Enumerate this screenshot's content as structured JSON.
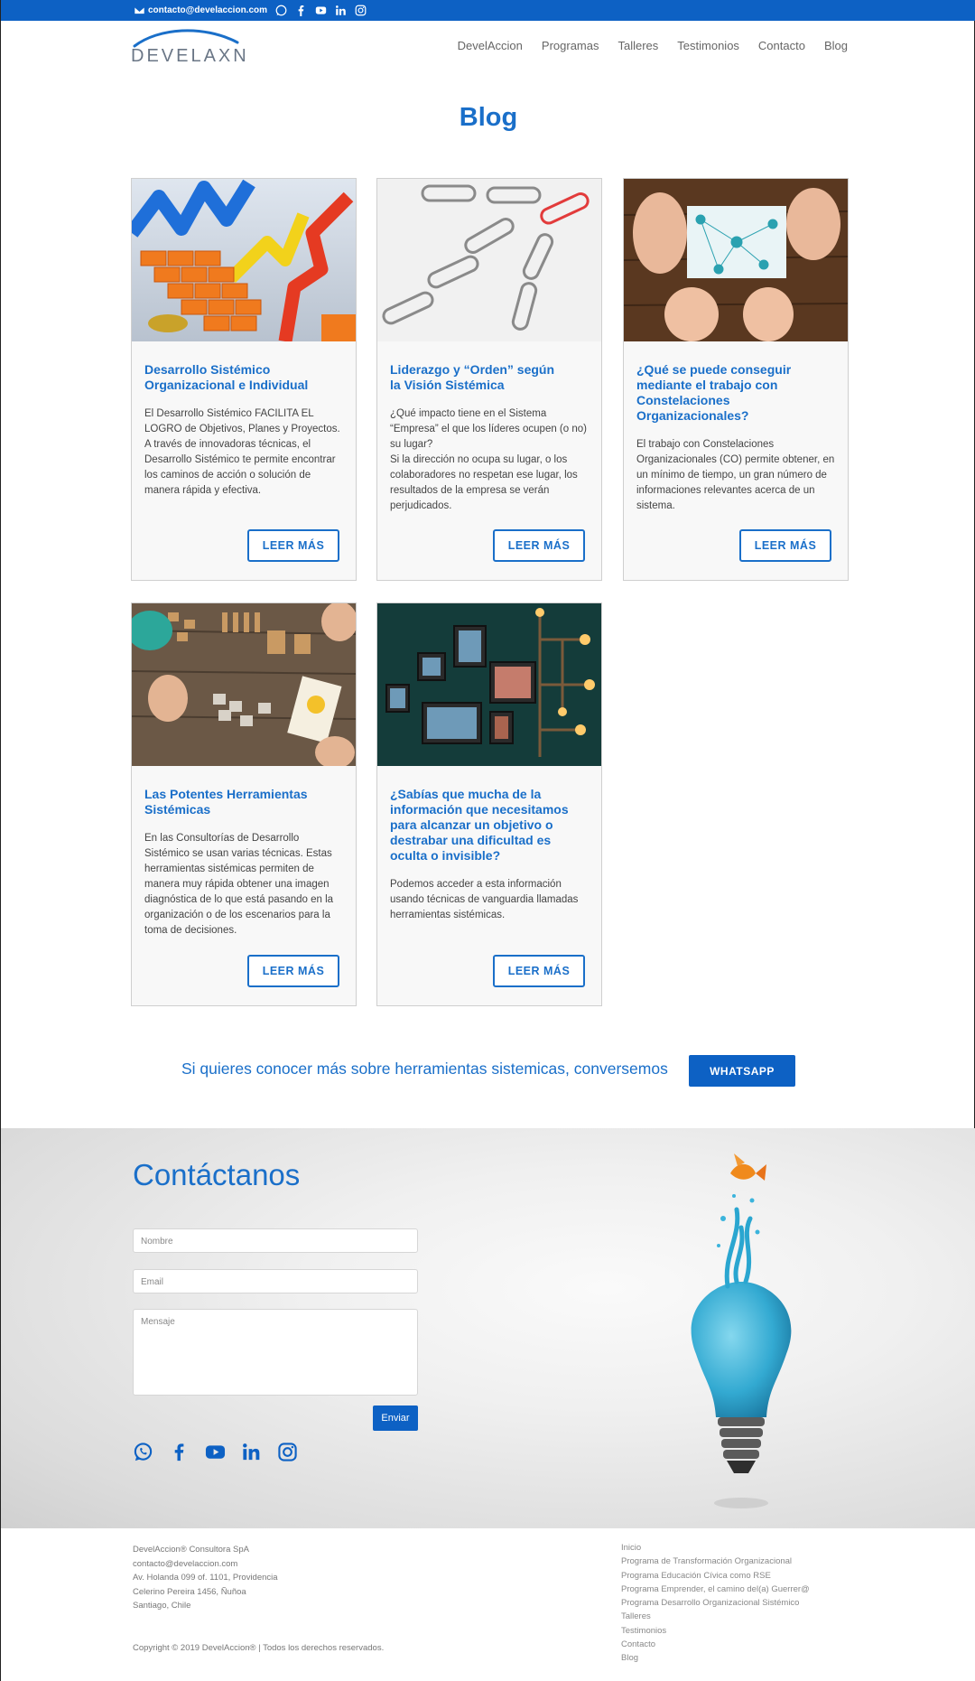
{
  "topbar": {
    "email": "contacto@develaccion.com",
    "icons": [
      "envelope-icon",
      "whatsapp-icon",
      "facebook-icon",
      "youtube-icon",
      "linkedin-icon",
      "instagram-icon"
    ]
  },
  "header": {
    "logo_text": "DEVELAXN",
    "nav": [
      "DevelAccion",
      "Programas",
      "Talleres",
      "Testimonios",
      "Contacto",
      "Blog"
    ]
  },
  "page": {
    "title": "Blog"
  },
  "posts": [
    {
      "title": "Desarrollo Sistémico\nOrganizacional e Individual",
      "excerpt": "El Desarrollo Sistémico FACILITA EL LOGRO de Objetivos, Planes y Proyectos. A través de innovadoras técnicas, el Desarrollo Sistémico te permite encontrar los caminos de acción o solución de manera rápida y efectiva.",
      "button": "LEER MÁS",
      "image": "arrows-and-bricks-image"
    },
    {
      "title": "Liderazgo y “Orden” según\nla Visión Sistémica",
      "excerpt": "¿Qué impacto tiene en el Sistema “Empresa” el que los líderes ocupen (o no) su lugar?\nSi la dirección no ocupa su lugar, o los colaboradores no respetan ese lugar, los resultados de la empresa se verán perjudicados.",
      "button": "LEER MÁS",
      "image": "paper-clips-image"
    },
    {
      "title": "¿Qué se puede conseguir mediante el trabajo con Constelaciones Organizacionales?",
      "excerpt": "El trabajo con Constelaciones Organizacionales (CO) permite obtener, en un mínimo de tiempo, un gran número de informaciones relevantes acerca de un sistema.",
      "button": "LEER MÁS",
      "image": "puzzle-network-image"
    },
    {
      "title": "Las Potentes Herramientas Sistémicas",
      "excerpt": "En las Consultorías de Desarrollo Sistémico se usan varias técnicas. Estas herramientas sistémicas permiten de manera muy rápida obtener una imagen diagnóstica de lo que está pasando en la organización o de los escenarios para la toma de decisiones.",
      "button": "LEER MÁS",
      "image": "puzzle-table-image"
    },
    {
      "title": "¿Sabías que mucha de la información que necesitamos para alcanzar un objetivo o destrabar una dificultad es oculta o invisible?",
      "excerpt": "Podemos acceder a esta información usando técnicas de vanguardia llamadas herramientas sistémicas.",
      "button": "LEER MÁS",
      "image": "frames-wall-image"
    }
  ],
  "cta": {
    "text": "Si quieres conocer más sobre herramientas sistemicas, conversemos",
    "button": "WHATSAPP"
  },
  "contact": {
    "title": "Contáctanos",
    "name_placeholder": "Nombre",
    "email_placeholder": "Email",
    "message_placeholder": "Mensaje",
    "send": "Enviar",
    "socials": [
      "whatsapp-icon",
      "facebook-icon",
      "youtube-icon",
      "linkedin-icon",
      "instagram-icon"
    ]
  },
  "footer": {
    "company": "DevelAccion® Consultora SpA",
    "email": "contacto@develaccion.com",
    "address1": "Av. Holanda 099 of. 1101, Providencia",
    "address2": "Celerino Pereira 1456, Ñuñoa",
    "city": "Santiago, Chile",
    "copyright": "Copyright © 2019 DevelAccion® | Todos los derechos reservados.",
    "links": [
      "Inicio",
      "Programa de Transformación Organizacional",
      "Programa Educación Cívica como RSE",
      "Programa Emprender, el camino del(a) Guerrer@",
      "Programa Desarrollo Organizacional Sistémico",
      "Talleres",
      "Testimonios",
      "Contacto",
      "Blog"
    ]
  },
  "colors": {
    "brand": "#0d61c4",
    "link": "#1a6fc9"
  }
}
